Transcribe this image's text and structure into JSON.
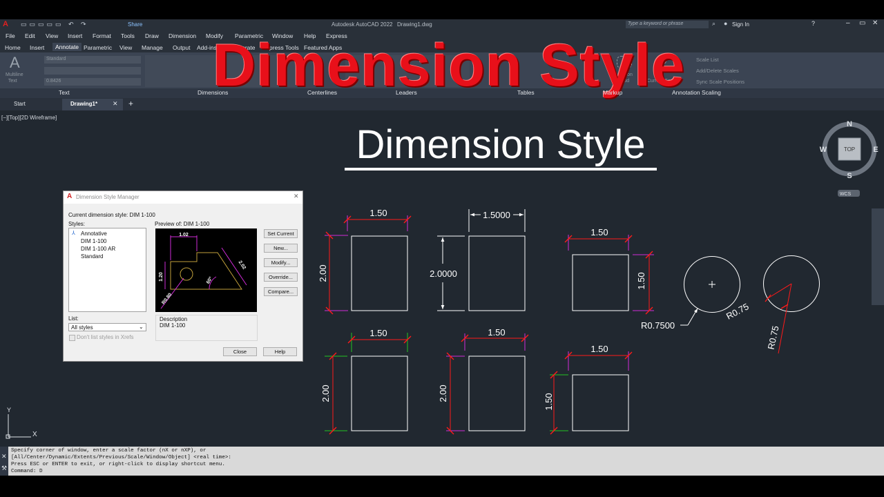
{
  "app": {
    "title": "Autodesk AutoCAD 2022",
    "file": "Drawing1.dwg",
    "share": "Share",
    "search_placeholder": "Type a keyword or phrase",
    "sign_in": "Sign In"
  },
  "overlay_title": "Dimension Style",
  "canvas_title": "Dimension Style",
  "menu": [
    "File",
    "Edit",
    "View",
    "Insert",
    "Format",
    "Tools",
    "Draw",
    "Dimension",
    "Modify",
    "Parametric",
    "Window",
    "Help",
    "Express"
  ],
  "ribbon_tabs": [
    "Home",
    "Insert",
    "Annotate",
    "Parametric",
    "View",
    "Manage",
    "Output",
    "Add-ins",
    "Collaborate",
    "Express Tools",
    "Featured Apps"
  ],
  "ribbon": {
    "text_style": "Standard",
    "text_height": "0.8426",
    "multiline_text": "Multiline\nText",
    "panels": [
      "Text",
      "Dimensions",
      "Centerlines",
      "Leaders",
      "Tables",
      "Markup",
      "Annotation Scaling"
    ],
    "revision_cloud": "Revision\nCloud",
    "add_current_scale": "Add\nCurrent Scale",
    "scale_list": "Scale List",
    "add_delete_scales": "Add/Delete Scales",
    "sync_scale_positions": "Sync Scale Positions"
  },
  "doc_tabs": {
    "start": "Start",
    "drawing": "Drawing1*"
  },
  "viewport_label": "[−][Top][2D Wireframe]",
  "viewcube": {
    "top": "TOP",
    "n": "N",
    "s": "S",
    "e": "E",
    "w": "W",
    "wcs": "WCS"
  },
  "dialog": {
    "title": "Dimension Style Manager",
    "current_style": "Current dimension style: DIM 1-100",
    "styles_label": "Styles:",
    "styles": [
      "Annotative",
      "DIM 1-100",
      "DIM 1-100 AR",
      "Standard"
    ],
    "preview_label": "Preview of: DIM 1-100",
    "buttons": {
      "set_current": "Set Current",
      "new": "New...",
      "modify": "Modify...",
      "override": "Override...",
      "compare": "Compare...",
      "close": "Close",
      "help": "Help"
    },
    "list_label": "List:",
    "list_value": "All styles",
    "xrefs_label": "Don't list styles in Xrefs",
    "description_label": "Description",
    "description_value": "DIM 1-100",
    "preview_dims": {
      "top": "1.02",
      "left": "1.20",
      "diag": "2.02",
      "angle": "60°",
      "radius": "R0.80"
    }
  },
  "drawing_dims": {
    "a_w": "1.50",
    "a_h": "2.00",
    "b_w": "1.5000",
    "b_h": "2.0000",
    "c_w": "1.50",
    "c_h": "1.50",
    "d_w": "1.50",
    "d_h": "2.00",
    "e_w": "1.50",
    "e_h": "2.00",
    "f_w": "1.50",
    "f_h": "1.50",
    "circle1_r": "R0.7500",
    "circle2_r1": "R0.75",
    "circle2_r2": "R0.75"
  },
  "command": {
    "line1": "Specify corner of window, enter a scale factor (nX or nXP), or",
    "line2": "[All/Center/Dynamic/Extents/Previous/Scale/Window/Object] <real time>:",
    "line3": "Press ESC or ENTER to exit, or right-click to display shortcut menu.",
    "line4": "Command: D"
  },
  "colors": {
    "red_title": "#e8101a",
    "dim_red": "#ff1a1a",
    "dim_magenta": "#d12bd8",
    "dim_green": "#22c322",
    "canvas": "#212830"
  }
}
